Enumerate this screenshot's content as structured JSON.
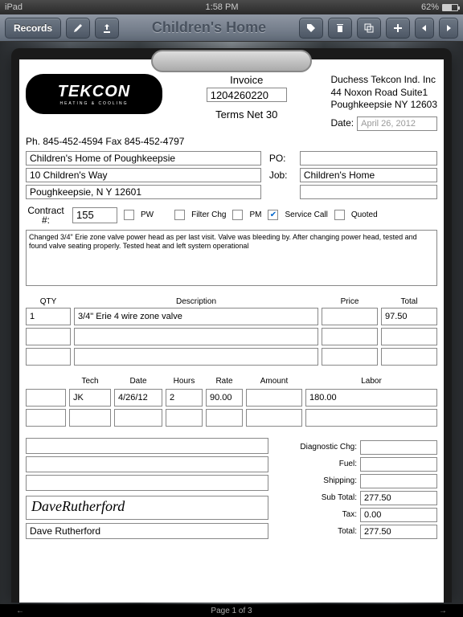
{
  "status": {
    "device": "iPad",
    "time": "1:58 PM",
    "battery": "62%"
  },
  "toolbar": {
    "records": "Records",
    "title": "Children's Home"
  },
  "logo": {
    "name": "TEKCON",
    "tag": "HEATING & COOLING"
  },
  "header": {
    "invoice_lbl": "Invoice",
    "invoice_no": "1204260220",
    "terms": "Terms Net 30"
  },
  "company": {
    "l1": "Duchess Tekcon Ind. Inc",
    "l2": "44 Noxon Road Suite1",
    "l3": "Poughkeepsie NY 12603"
  },
  "phone": "Ph. 845-452-4594 Fax 845-452-4797",
  "date": {
    "lbl": "Date:",
    "val": "April 26, 2012"
  },
  "po": {
    "lbl": "PO:",
    "val": ""
  },
  "job": {
    "lbl": "Job:",
    "val": "Children's Home"
  },
  "cust": {
    "name": "Children's Home of Poughkeepsie",
    "addr": "10 Children's Way",
    "city": "Poughkeepsie, N Y 12601"
  },
  "contract": {
    "lbl": "Contract #:",
    "val": "155"
  },
  "checks": {
    "pw": "PW",
    "filter": "Filter Chg",
    "pm": "PM",
    "service": "Service Call",
    "quoted": "Quoted"
  },
  "notes": "Changed 3/4\" Erie zone valve power head as per last visit. Valve was bleeding by.  After changing power head, tested and found valve seating properly.   Tested heat and left system operational",
  "cols": {
    "qty": "QTY",
    "desc": "Description",
    "price": "Price",
    "total": "Total"
  },
  "lines": [
    {
      "qty": "1",
      "desc": "3/4\" Erie 4 wire zone valve",
      "price": "",
      "total": "97.50"
    },
    {
      "qty": "",
      "desc": "",
      "price": "",
      "total": ""
    },
    {
      "qty": "",
      "desc": "",
      "price": "",
      "total": ""
    }
  ],
  "labor_hdr": {
    "tech": "Tech",
    "date": "Date",
    "hours": "Hours",
    "rate": "Rate",
    "amount": "Amount",
    "labor": "Labor"
  },
  "labor": {
    "tech": "JK",
    "date": "4/26/12",
    "hours": "2",
    "rate": "90.00",
    "amount": "",
    "labor": "180.00"
  },
  "totals": {
    "diag": "Diagnostic  Chg:",
    "fuel": "Fuel:",
    "ship": "Shipping:",
    "sub": "Sub Total:",
    "tax": "Tax:",
    "total": "Total:",
    "sub_v": "277.50",
    "tax_v": "0.00",
    "total_v": "277.50"
  },
  "sig": {
    "img": "DaveRutherford",
    "name": "Dave Rutherford"
  },
  "footer": "Page 1 of 3"
}
